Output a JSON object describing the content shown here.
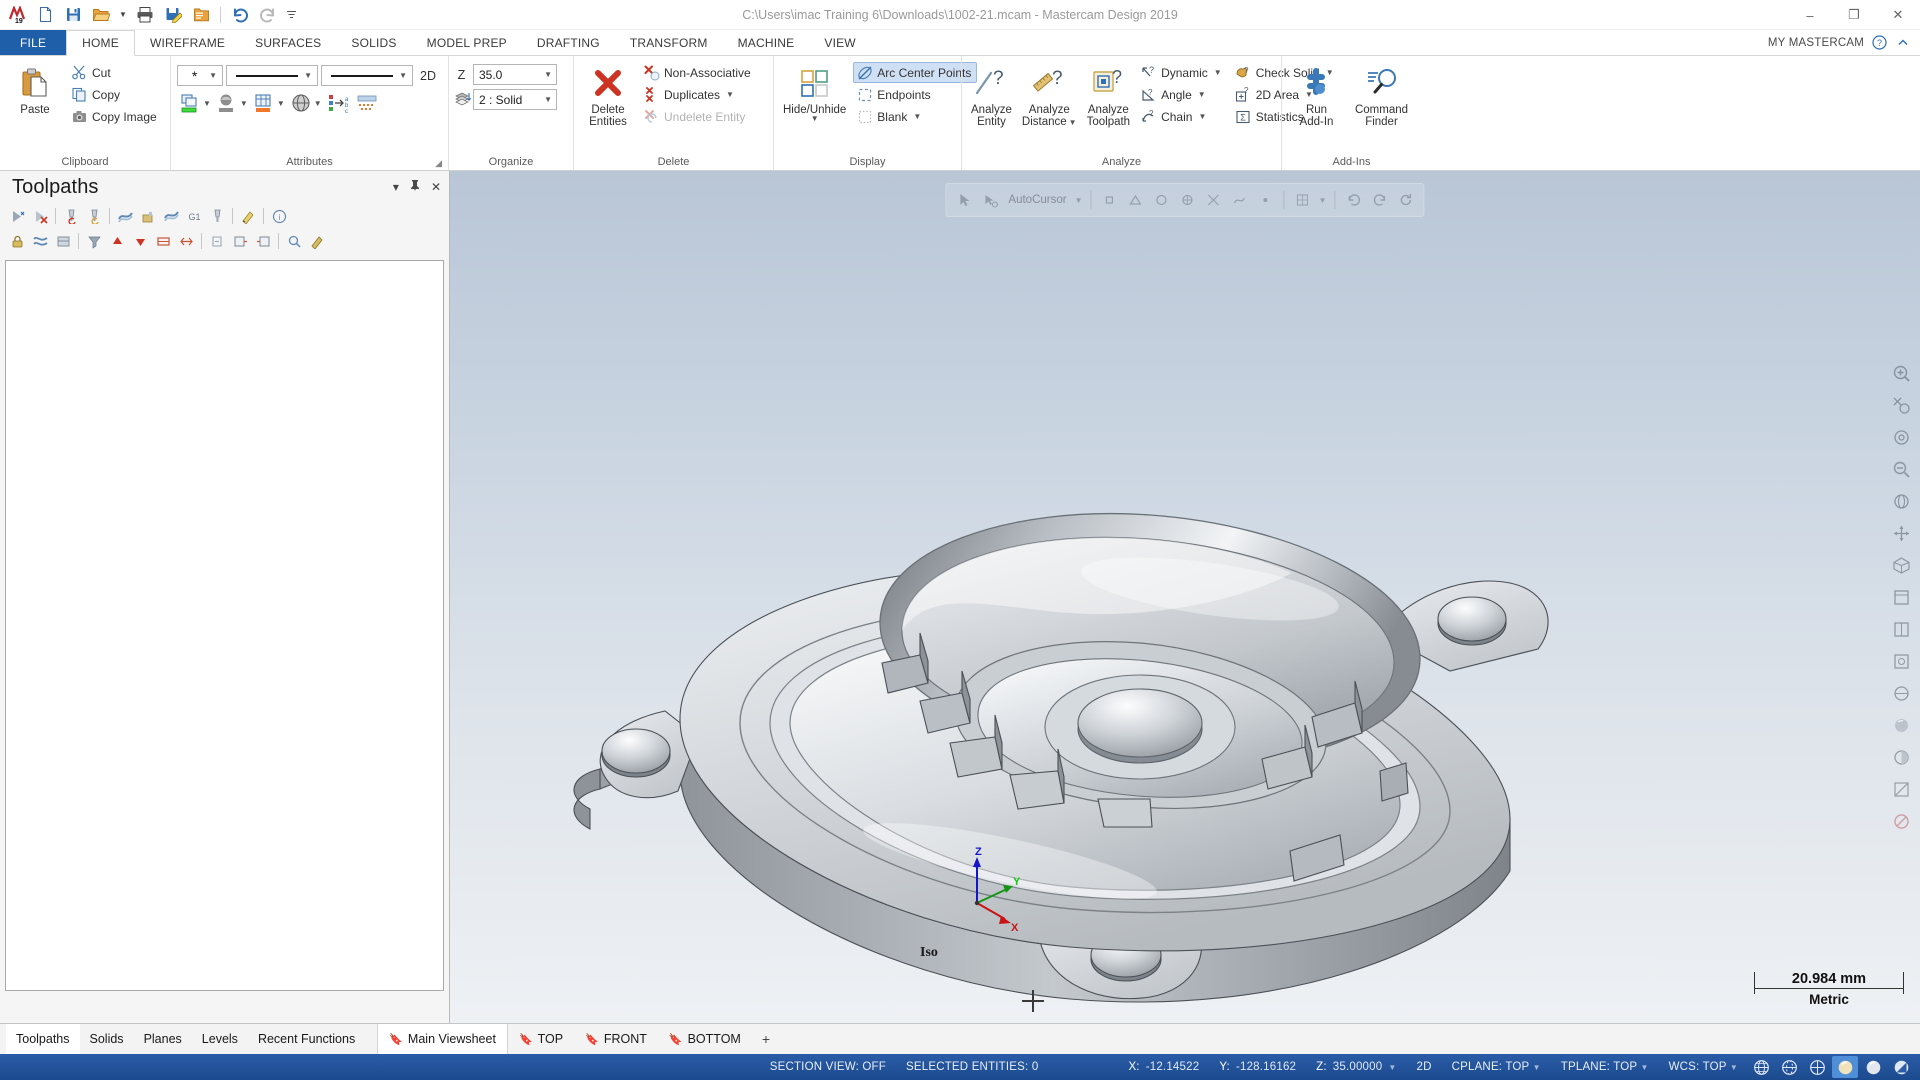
{
  "window": {
    "title": "C:\\Users\\imac Training 6\\Downloads\\1002-21.mcam - Mastercam Design 2019",
    "minimize": "–",
    "maximize": "❐",
    "close": "✕"
  },
  "quick_access": [
    {
      "name": "app-logo-icon",
      "label": "M"
    },
    {
      "name": "new-file-icon",
      "label": "New"
    },
    {
      "name": "save-icon",
      "label": "Save"
    },
    {
      "name": "open-folder-icon",
      "label": "Open"
    },
    {
      "name": "print-icon",
      "label": "Print"
    },
    {
      "name": "save-as-icon",
      "label": "Save As"
    },
    {
      "name": "folder-properties-icon",
      "label": "File Properties"
    },
    {
      "name": "undo-icon",
      "label": "Undo"
    },
    {
      "name": "redo-icon",
      "label": "Redo"
    },
    {
      "name": "customize-qat-icon",
      "label": "Customize"
    }
  ],
  "ribbon": {
    "tabs": [
      {
        "label": "FILE",
        "type": "file"
      },
      {
        "label": "HOME",
        "active": true
      },
      {
        "label": "WIREFRAME"
      },
      {
        "label": "SURFACES"
      },
      {
        "label": "SOLIDS"
      },
      {
        "label": "MODEL PREP"
      },
      {
        "label": "DRAFTING"
      },
      {
        "label": "TRANSFORM"
      },
      {
        "label": "MACHINE"
      },
      {
        "label": "VIEW"
      }
    ],
    "my_mastercam": "MY MASTERCAM",
    "help_icon": "help-icon",
    "collapse_icon": "chevron-up-icon",
    "groups": {
      "clipboard": {
        "label": "Clipboard",
        "paste": "Paste",
        "cut": "Cut",
        "copy": "Copy",
        "copy_image": "Copy Image"
      },
      "attributes": {
        "label": "Attributes",
        "point_style": "*",
        "line_style": "———",
        "line_width": "———",
        "twod_label": "2D",
        "icon_row": [
          "color-attribute-icon",
          "level-attribute-icon",
          "line-attribute-icon",
          "wire-display-icon",
          "set-all-attributes-icon",
          "clear-colors-icon"
        ]
      },
      "organize": {
        "label": "Organize",
        "z_label": "Z",
        "z_value": "35.0",
        "level_value": "2 : Solid"
      },
      "delete": {
        "label": "Delete",
        "delete_entities": "Delete\nEntities",
        "delete_entities_line1": "Delete",
        "delete_entities_line2": "Entities",
        "non_associative": "Non-Associative",
        "duplicates": "Duplicates",
        "undelete_entity": "Undelete Entity"
      },
      "display": {
        "label": "Display",
        "hide_unhide_line1": "Hide/Unhide",
        "arc_center_points": "Arc Center Points",
        "endpoints": "Endpoints",
        "blank": "Blank"
      },
      "analyze": {
        "label": "Analyze",
        "analyze_entity_l1": "Analyze",
        "analyze_entity_l2": "Entity",
        "analyze_distance_l1": "Analyze",
        "analyze_distance_l2": "Distance",
        "analyze_toolpath_l1": "Analyze",
        "analyze_toolpath_l2": "Toolpath",
        "dynamic": "Dynamic",
        "angle": "Angle",
        "chain": "Chain",
        "check_solid": "Check Solid",
        "twod_area": "2D Area",
        "statistics": "Statistics"
      },
      "addins": {
        "label": "Add-Ins",
        "run_addin_l1": "Run",
        "run_addin_l2": "Add-In",
        "command_finder_l1": "Command",
        "command_finder_l2": "Finder"
      }
    }
  },
  "toolpaths_panel": {
    "title": "Toolpaths",
    "header_buttons": [
      {
        "name": "panel-menu-icon",
        "glyph": "▾"
      },
      {
        "name": "panel-pin-icon",
        "glyph": "📌"
      },
      {
        "name": "panel-close-icon",
        "glyph": "✕"
      }
    ],
    "toolbar_row1": [
      "select-all-toolpaths-icon",
      "delete-toolpath-icon",
      "regenerate-selected-icon",
      "regenerate-all-dirty-icon",
      "backplot-icon",
      "verify-icon",
      "simulate-icon",
      "post-g1-icon",
      "high-speed-toolpath-icon",
      "toolpath-settings-icon",
      "help-toolpath-icon"
    ],
    "toolbar_row2": [
      "lock-toolpath-icon",
      "toggle-posting-icon",
      "toggle-toolpath-display-icon",
      "filter-icon",
      "move-up-icon",
      "move-down-icon",
      "sort-icon",
      "expand-icon",
      "collapse-icon",
      "import-toolpath-icon",
      "export-toolpath-icon",
      "search-toolpath-icon",
      "edit-toolpath-icon"
    ],
    "tabs": [
      {
        "label": "Toolpaths",
        "active": true
      },
      {
        "label": "Solids"
      },
      {
        "label": "Planes"
      },
      {
        "label": "Levels"
      },
      {
        "label": "Recent Functions"
      }
    ]
  },
  "viewport": {
    "float_toolbar": {
      "autocursor_label": "AutoCursor",
      "items": [
        "cursor-select-icon",
        "autocursor-icon",
        "snap-endpoint-icon",
        "snap-midpoint-icon",
        "snap-center-icon",
        "snap-quadrant-icon",
        "snap-intersection-icon",
        "snap-nearest-icon",
        "snap-point-icon",
        "grid-snap-icon",
        "relative-snap-icon",
        "undo-view-icon",
        "redo-view-icon",
        "refresh-view-icon"
      ]
    },
    "right_rail": [
      "fit-to-window-icon",
      "zoom-window-icon",
      "zoom-target-icon",
      "unzoom-icon",
      "dynamic-rotate-icon",
      "pan-icon",
      "isometric-view-icon",
      "top-view-icon",
      "front-view-icon",
      "right-view-icon",
      "wireframe-shading-icon",
      "shaded-view-icon",
      "translucency-icon",
      "section-view-icon",
      "no-display-icon"
    ],
    "gnomon": {
      "x": "X",
      "y": "Y",
      "z": "Z"
    },
    "view_name": "Iso",
    "scale": {
      "value": "20.984 mm",
      "units": "Metric"
    }
  },
  "viewsheets": {
    "items": [
      {
        "label": "Main Viewsheet",
        "active": true
      },
      {
        "label": "TOP"
      },
      {
        "label": "FRONT"
      },
      {
        "label": "BOTTOM"
      }
    ],
    "add": "+",
    "bookmark_icon": "bookmark-icon"
  },
  "statusbar": {
    "section_view": "SECTION VIEW: OFF",
    "selected_entities": "SELECTED ENTITIES: 0",
    "coords": [
      {
        "key": "X:",
        "value": "-12.14522"
      },
      {
        "key": "Y:",
        "value": "-128.16162"
      },
      {
        "key": "Z:",
        "value": "35.00000"
      }
    ],
    "dimension_mode": "2D",
    "cplane": "CPLANE: TOP",
    "tplane": "TPLANE: TOP",
    "wcs": "WCS: TOP",
    "icons": [
      {
        "name": "wireframe-display-icon",
        "selected": false
      },
      {
        "name": "hidden-lines-display-icon",
        "selected": false
      },
      {
        "name": "hidden-lines-grayed-icon",
        "selected": false
      },
      {
        "name": "shaded-display-icon",
        "selected": true
      },
      {
        "name": "shaded-with-edges-icon",
        "selected": false
      },
      {
        "name": "material-display-icon",
        "selected": false
      }
    ]
  }
}
